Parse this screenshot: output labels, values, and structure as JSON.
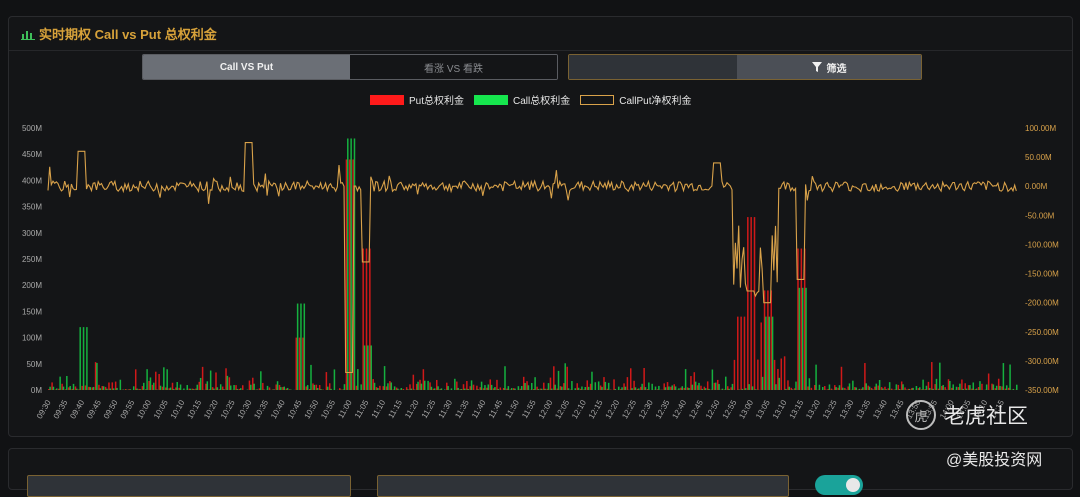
{
  "panel": {
    "title": "实时期权 Call vs Put 总权利金"
  },
  "toggle": {
    "active": "Call VS Put",
    "inactive": "看涨 VS 看跌"
  },
  "filter": {
    "label": "筛选"
  },
  "watermark": {
    "brand": "老虎社区",
    "sub": "@美股投资网"
  },
  "colors": {
    "put": "#ff1a1a",
    "call": "#16e64e",
    "net": "#d9a24a",
    "bg": "#141517"
  },
  "chart_data": {
    "type": "bar",
    "title": "",
    "legend": [
      "Put总权利金",
      "Call总权利金",
      "CallPut净权利金"
    ],
    "legend_position": "top-center",
    "y_left": {
      "ticks": [
        "0M",
        "50M",
        "100M",
        "150M",
        "200M",
        "250M",
        "300M",
        "350M",
        "400M",
        "450M",
        "500M"
      ],
      "min": 0,
      "max": 500
    },
    "y_right": {
      "ticks": [
        "100.00M",
        "50.00M",
        "0.00M",
        "-50.00M",
        "-100.00M",
        "-150.00M",
        "-200.00M",
        "-250.00M",
        "-300.00M",
        "-350.00M"
      ],
      "min": -350,
      "max": 100
    },
    "x_ticks": [
      "09:30",
      "09:35",
      "09:40",
      "09:45",
      "09:50",
      "09:55",
      "10:00",
      "10:05",
      "10:10",
      "10:15",
      "10:20",
      "10:25",
      "10:30",
      "10:35",
      "10:40",
      "10:45",
      "10:50",
      "10:55",
      "11:00",
      "11:05",
      "11:10",
      "11:15",
      "11:20",
      "11:25",
      "11:30",
      "11:35",
      "11:40",
      "11:45",
      "11:50",
      "11:55",
      "12:00",
      "12:05",
      "12:10",
      "12:15",
      "12:20",
      "12:25",
      "12:30",
      "12:35",
      "12:40",
      "12:45",
      "12:50",
      "12:55",
      "13:00",
      "13:05",
      "13:10",
      "13:15",
      "13:20",
      "13:25",
      "13:30",
      "13:35",
      "13:40",
      "13:45",
      "13:50",
      "13:55",
      "14:00",
      "14:05",
      "14:10",
      "14:15"
    ],
    "series_summary": [
      {
        "name": "Put总权利金",
        "peaks": [
          {
            "x": "10:45",
            "value": 100
          },
          {
            "x": "11:00",
            "value": 440
          },
          {
            "x": "11:05",
            "value": 270
          },
          {
            "x": "12:57",
            "value": 140
          },
          {
            "x": "13:00",
            "value": 330
          },
          {
            "x": "13:05",
            "value": 190
          },
          {
            "x": "13:15",
            "value": 270
          }
        ]
      },
      {
        "name": "Call总权利金",
        "peaks": [
          {
            "x": "09:40",
            "value": 120
          },
          {
            "x": "10:45",
            "value": 165
          },
          {
            "x": "11:00",
            "value": 480
          },
          {
            "x": "11:05",
            "value": 85
          },
          {
            "x": "13:05",
            "value": 140
          },
          {
            "x": "13:15",
            "value": 195
          }
        ]
      },
      {
        "name": "CallPut净权利金",
        "peaks": [
          {
            "x": "09:40",
            "value": 60
          },
          {
            "x": "10:30",
            "value": 75
          },
          {
            "x": "11:00",
            "value": -320
          },
          {
            "x": "11:05",
            "value": -130
          },
          {
            "x": "12:50",
            "value": 40
          },
          {
            "x": "13:00",
            "value": -180
          },
          {
            "x": "13:05",
            "value": -200
          },
          {
            "x": "13:15",
            "value": -160
          }
        ]
      }
    ]
  }
}
